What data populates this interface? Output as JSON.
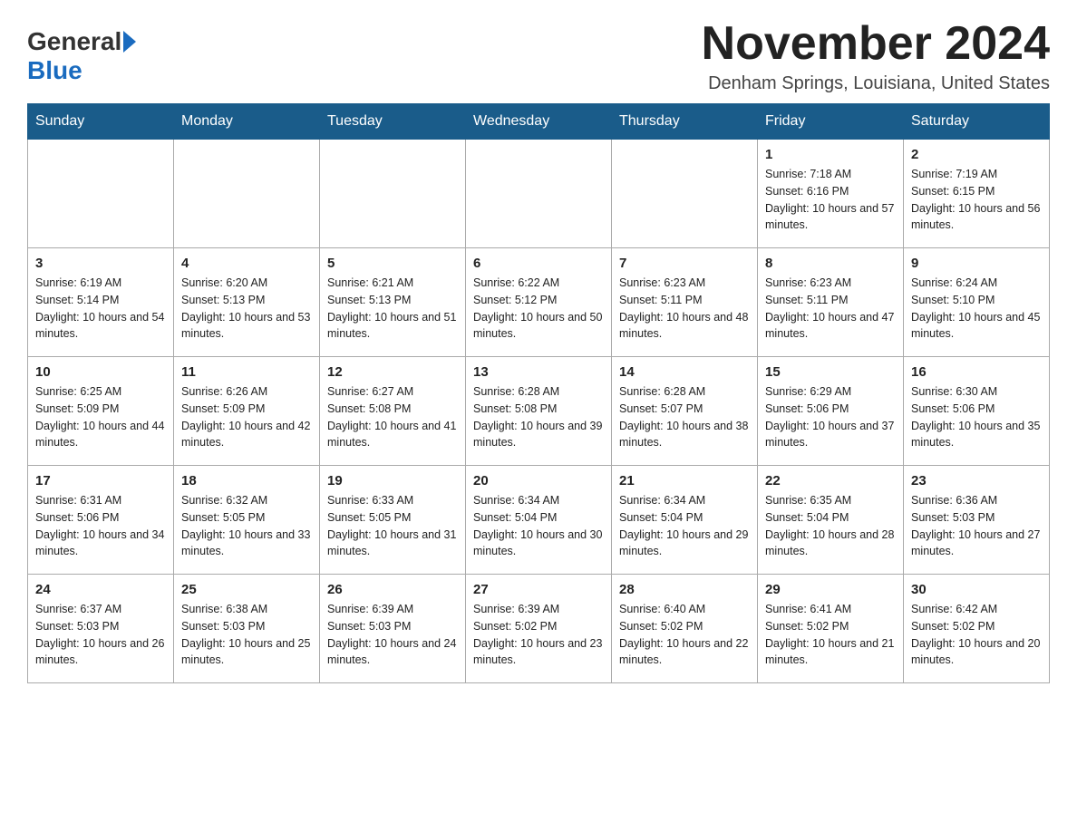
{
  "logo": {
    "general": "General",
    "blue": "Blue"
  },
  "title": "November 2024",
  "location": "Denham Springs, Louisiana, United States",
  "days_of_week": [
    "Sunday",
    "Monday",
    "Tuesday",
    "Wednesday",
    "Thursday",
    "Friday",
    "Saturday"
  ],
  "weeks": [
    [
      {
        "day": "",
        "info": ""
      },
      {
        "day": "",
        "info": ""
      },
      {
        "day": "",
        "info": ""
      },
      {
        "day": "",
        "info": ""
      },
      {
        "day": "",
        "info": ""
      },
      {
        "day": "1",
        "info": "Sunrise: 7:18 AM\nSunset: 6:16 PM\nDaylight: 10 hours and 57 minutes."
      },
      {
        "day": "2",
        "info": "Sunrise: 7:19 AM\nSunset: 6:15 PM\nDaylight: 10 hours and 56 minutes."
      }
    ],
    [
      {
        "day": "3",
        "info": "Sunrise: 6:19 AM\nSunset: 5:14 PM\nDaylight: 10 hours and 54 minutes."
      },
      {
        "day": "4",
        "info": "Sunrise: 6:20 AM\nSunset: 5:13 PM\nDaylight: 10 hours and 53 minutes."
      },
      {
        "day": "5",
        "info": "Sunrise: 6:21 AM\nSunset: 5:13 PM\nDaylight: 10 hours and 51 minutes."
      },
      {
        "day": "6",
        "info": "Sunrise: 6:22 AM\nSunset: 5:12 PM\nDaylight: 10 hours and 50 minutes."
      },
      {
        "day": "7",
        "info": "Sunrise: 6:23 AM\nSunset: 5:11 PM\nDaylight: 10 hours and 48 minutes."
      },
      {
        "day": "8",
        "info": "Sunrise: 6:23 AM\nSunset: 5:11 PM\nDaylight: 10 hours and 47 minutes."
      },
      {
        "day": "9",
        "info": "Sunrise: 6:24 AM\nSunset: 5:10 PM\nDaylight: 10 hours and 45 minutes."
      }
    ],
    [
      {
        "day": "10",
        "info": "Sunrise: 6:25 AM\nSunset: 5:09 PM\nDaylight: 10 hours and 44 minutes."
      },
      {
        "day": "11",
        "info": "Sunrise: 6:26 AM\nSunset: 5:09 PM\nDaylight: 10 hours and 42 minutes."
      },
      {
        "day": "12",
        "info": "Sunrise: 6:27 AM\nSunset: 5:08 PM\nDaylight: 10 hours and 41 minutes."
      },
      {
        "day": "13",
        "info": "Sunrise: 6:28 AM\nSunset: 5:08 PM\nDaylight: 10 hours and 39 minutes."
      },
      {
        "day": "14",
        "info": "Sunrise: 6:28 AM\nSunset: 5:07 PM\nDaylight: 10 hours and 38 minutes."
      },
      {
        "day": "15",
        "info": "Sunrise: 6:29 AM\nSunset: 5:06 PM\nDaylight: 10 hours and 37 minutes."
      },
      {
        "day": "16",
        "info": "Sunrise: 6:30 AM\nSunset: 5:06 PM\nDaylight: 10 hours and 35 minutes."
      }
    ],
    [
      {
        "day": "17",
        "info": "Sunrise: 6:31 AM\nSunset: 5:06 PM\nDaylight: 10 hours and 34 minutes."
      },
      {
        "day": "18",
        "info": "Sunrise: 6:32 AM\nSunset: 5:05 PM\nDaylight: 10 hours and 33 minutes."
      },
      {
        "day": "19",
        "info": "Sunrise: 6:33 AM\nSunset: 5:05 PM\nDaylight: 10 hours and 31 minutes."
      },
      {
        "day": "20",
        "info": "Sunrise: 6:34 AM\nSunset: 5:04 PM\nDaylight: 10 hours and 30 minutes."
      },
      {
        "day": "21",
        "info": "Sunrise: 6:34 AM\nSunset: 5:04 PM\nDaylight: 10 hours and 29 minutes."
      },
      {
        "day": "22",
        "info": "Sunrise: 6:35 AM\nSunset: 5:04 PM\nDaylight: 10 hours and 28 minutes."
      },
      {
        "day": "23",
        "info": "Sunrise: 6:36 AM\nSunset: 5:03 PM\nDaylight: 10 hours and 27 minutes."
      }
    ],
    [
      {
        "day": "24",
        "info": "Sunrise: 6:37 AM\nSunset: 5:03 PM\nDaylight: 10 hours and 26 minutes."
      },
      {
        "day": "25",
        "info": "Sunrise: 6:38 AM\nSunset: 5:03 PM\nDaylight: 10 hours and 25 minutes."
      },
      {
        "day": "26",
        "info": "Sunrise: 6:39 AM\nSunset: 5:03 PM\nDaylight: 10 hours and 24 minutes."
      },
      {
        "day": "27",
        "info": "Sunrise: 6:39 AM\nSunset: 5:02 PM\nDaylight: 10 hours and 23 minutes."
      },
      {
        "day": "28",
        "info": "Sunrise: 6:40 AM\nSunset: 5:02 PM\nDaylight: 10 hours and 22 minutes."
      },
      {
        "day": "29",
        "info": "Sunrise: 6:41 AM\nSunset: 5:02 PM\nDaylight: 10 hours and 21 minutes."
      },
      {
        "day": "30",
        "info": "Sunrise: 6:42 AM\nSunset: 5:02 PM\nDaylight: 10 hours and 20 minutes."
      }
    ]
  ]
}
